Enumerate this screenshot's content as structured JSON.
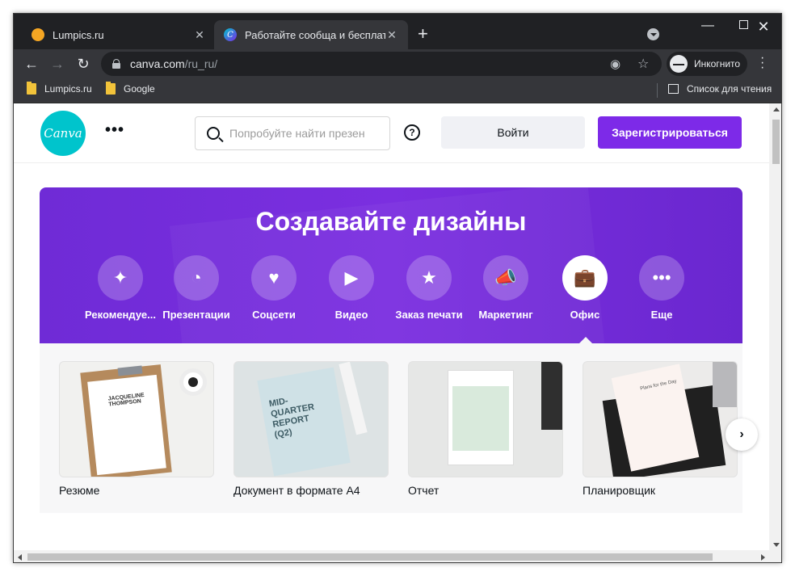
{
  "browser": {
    "tabs": [
      {
        "title": "Lumpics.ru",
        "favicon": "lumpics-favicon",
        "active": false
      },
      {
        "title": "Работайте сообща и бесплатно",
        "favicon": "canva-favicon",
        "active": true
      }
    ],
    "new_tab_label": "+",
    "address": {
      "host": "canva.com",
      "path": "/ru_ru/"
    },
    "incognito_label": "Инкогнито",
    "bookmarks": [
      {
        "label": "Lumpics.ru",
        "icon": "folder-icon"
      },
      {
        "label": "Google",
        "icon": "folder-icon"
      }
    ],
    "reading_list_label": "Список для чтения"
  },
  "canva": {
    "logo_text": "Canva",
    "search": {
      "placeholder": "Попробуйте найти презен",
      "value": ""
    },
    "help_label": "?",
    "login_label": "Войти",
    "signup_label": "Зарегистрироваться",
    "hero": {
      "title": "Создавайте дизайны",
      "categories": [
        {
          "label": "Рекомендуе...",
          "icon": "sparkle-icon",
          "glyph": "✦"
        },
        {
          "label": "Презентации",
          "icon": "presentation-icon",
          "glyph": "◔"
        },
        {
          "label": "Соцсети",
          "icon": "heart-chat-icon",
          "glyph": "♥"
        },
        {
          "label": "Видео",
          "icon": "video-camera-icon",
          "glyph": "▶"
        },
        {
          "label": "Заказ печати",
          "icon": "print-order-icon",
          "glyph": "★"
        },
        {
          "label": "Маркетинг",
          "icon": "megaphone-icon",
          "glyph": "📣"
        },
        {
          "label": "Офис",
          "icon": "briefcase-icon",
          "glyph": "💼",
          "active": true
        },
        {
          "label": "Еще",
          "icon": "more-dots-icon",
          "glyph": "•••"
        }
      ]
    },
    "templates": [
      {
        "name": "Резюме",
        "thumb_text": "JACQUELINE THOMPSON"
      },
      {
        "name": "Документ в формате А4",
        "thumb_text": "MID- QUARTER REPORT (Q2)"
      },
      {
        "name": "Отчет",
        "thumb_text": ""
      },
      {
        "name": "Планировщик",
        "thumb_text": "Plans for the Day"
      }
    ]
  },
  "colors": {
    "brand_purple": "#7d2ae8",
    "canva_teal": "#00c4cc",
    "hero_gradient": "#6f2bd6"
  }
}
